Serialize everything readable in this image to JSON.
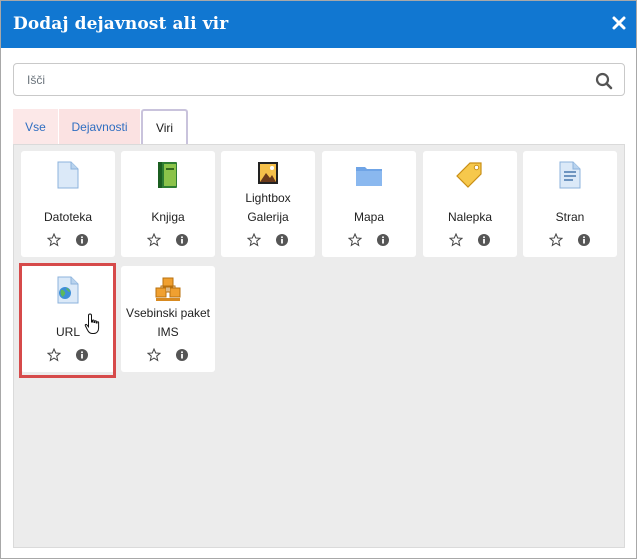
{
  "dialog": {
    "title": "Dodaj dejavnost ali vir"
  },
  "search": {
    "placeholder": "Išči"
  },
  "tabs": [
    {
      "label": "Vse"
    },
    {
      "label": "Dejavnosti"
    },
    {
      "label": "Viri",
      "selected": true
    }
  ],
  "items": [
    {
      "label": "Datoteka",
      "icon": "file-icon"
    },
    {
      "label": "Knjiga",
      "icon": "book-icon"
    },
    {
      "label": "Lightbox Galerija",
      "line1": "Lightbox",
      "line2": "Galerija",
      "icon": "gallery-icon"
    },
    {
      "label": "Mapa",
      "icon": "folder-icon"
    },
    {
      "label": "Nalepka",
      "icon": "tag-icon"
    },
    {
      "label": "Stran",
      "icon": "page-icon"
    },
    {
      "label": "URL",
      "icon": "url-icon"
    },
    {
      "label": "Vsebinski paket IMS",
      "line1": "Vsebinski paket",
      "line2": "IMS",
      "icon": "ims-package-icon"
    }
  ],
  "colors": {
    "header": "#1177d1",
    "highlight": "#d64a4a",
    "tab_inactive": "#fce8e8",
    "link": "#2f6ec1"
  }
}
